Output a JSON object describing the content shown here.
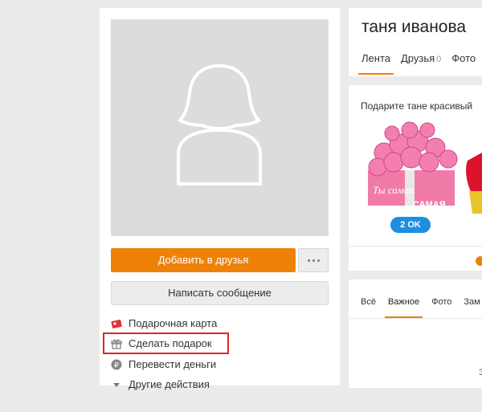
{
  "profile": {
    "name": "таня иванова",
    "add_friend_label": "Добавить в друзья",
    "write_message_label": "Написать сообщение",
    "actions": [
      {
        "label": "Подарочная карта",
        "icon": "gift-card-icon"
      },
      {
        "label": "Сделать подарок",
        "icon": "gift-icon"
      },
      {
        "label": "Перевести деньги",
        "icon": "money-icon"
      },
      {
        "label": "Другие действия",
        "icon": "chevron-down-icon"
      }
    ]
  },
  "header": {
    "tabs": [
      {
        "label": "Лента"
      },
      {
        "label": "Друзья",
        "count": "0"
      },
      {
        "label": "Фото"
      }
    ]
  },
  "gifts": {
    "title": "Подарите тане красивый",
    "price_badge": "2 OK",
    "card_text_1": "Ты самая",
    "card_text_2": "САМАЯ"
  },
  "feed": {
    "tabs": [
      "Всё",
      "Важное",
      "Фото",
      "Зам"
    ],
    "stub": "З"
  },
  "colors": {
    "accent": "#ee8208",
    "highlight": "#e0222a",
    "badge": "#1d8fe0"
  }
}
